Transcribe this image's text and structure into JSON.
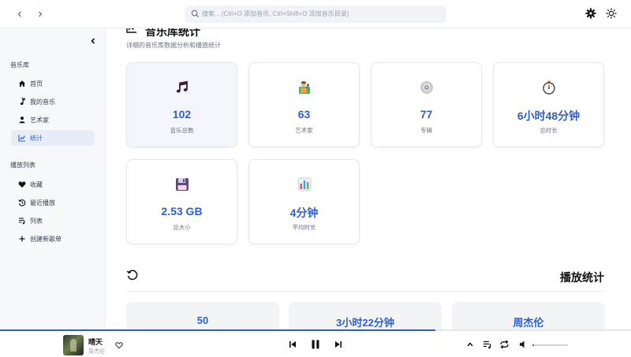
{
  "topbar": {
    "back_icon": "chevron-left-icon",
    "forward_icon": "chevron-right-icon",
    "search_placeholder": "搜索... (Ctrl+O 添加音乐, Ctrl+Shift+O 添加音乐目录)",
    "settings_icon": "gear-icon",
    "theme_icon": "sun-icon"
  },
  "sidebar": {
    "library_title": "音乐库",
    "library_items": [
      {
        "label": "首页",
        "icon": "home-icon"
      },
      {
        "label": "我的音乐",
        "icon": "music-note-icon"
      },
      {
        "label": "艺术家",
        "icon": "person-icon"
      },
      {
        "label": "统计",
        "icon": "chart-icon",
        "active": true
      }
    ],
    "playlist_title": "播放列表",
    "playlist_items": [
      {
        "label": "收藏",
        "icon": "heart-icon"
      },
      {
        "label": "最近播放",
        "icon": "history-icon"
      },
      {
        "label": "列表",
        "icon": "queue-icon"
      },
      {
        "label": "创建新歌单",
        "icon": "plus-icon"
      }
    ]
  },
  "main": {
    "title": "音乐库统计",
    "subtitle": "详细的音乐库数据分析和播放统计",
    "stats": [
      {
        "value": "102",
        "label": "音乐总数",
        "icon": "music-notes-icon",
        "highlight": true
      },
      {
        "value": "63",
        "label": "艺术家",
        "icon": "singer-icon"
      },
      {
        "value": "77",
        "label": "专辑",
        "icon": "disc-icon"
      },
      {
        "value": "6小时48分钟",
        "label": "总时长",
        "icon": "stopwatch-icon"
      },
      {
        "value": "2.53 GB",
        "label": "总大小",
        "icon": "floppy-disk-icon"
      },
      {
        "value": "4分钟",
        "label": "平均时长",
        "icon": "bar-chart-icon"
      }
    ],
    "play_stats_title": "播放统计",
    "play_stats": [
      {
        "value": "50"
      },
      {
        "value": "3小时22分钟"
      },
      {
        "value": "周杰伦"
      }
    ]
  },
  "player": {
    "song_title": "晴天",
    "artist": "周杰伦",
    "progress": 0.69,
    "volume": 0.05
  },
  "colors": {
    "accent": "#2f5fc8",
    "active_bg": "#e6edf9"
  }
}
